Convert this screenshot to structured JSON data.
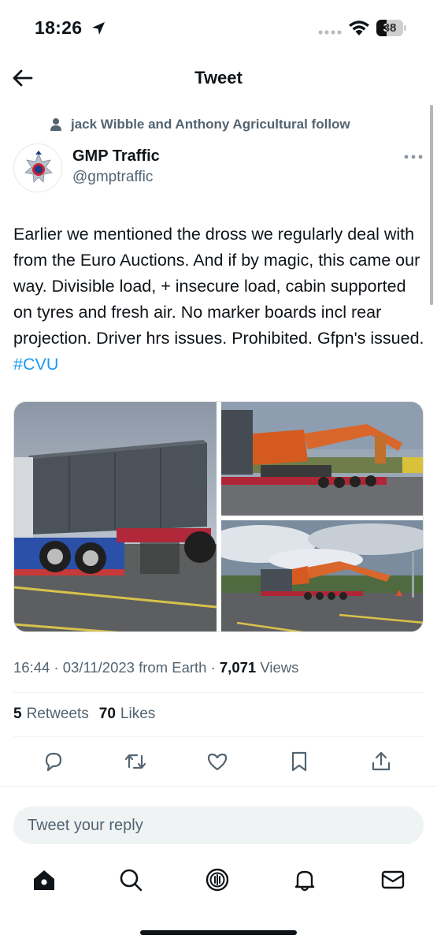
{
  "status_bar": {
    "time": "18:26",
    "battery": "38",
    "battery_level": 0.38
  },
  "header": {
    "title": "Tweet"
  },
  "social_context": "jack Wibble and Anthony Agricultural follow",
  "author": {
    "name": "GMP Traffic",
    "handle": "@gmptraffic"
  },
  "tweet": {
    "text": "Earlier we mentioned the dross we regularly deal with from the Euro Auctions. And if by magic, this came our way. Divisible load, + insecure load, cabin supported on tyres and fresh air. No marker boards incl rear projection. Driver hrs issues. Prohibited. Gfpn's issued.",
    "hashtag": "#CVU"
  },
  "meta": {
    "timestamp": "16:44 · 03/11/2023 from Earth · ",
    "views_count": "7,071",
    "views_label": " Views"
  },
  "stats": {
    "retweets_count": "5",
    "retweets_label": "Retweets",
    "likes_count": "70",
    "likes_label": "Likes"
  },
  "actions": [
    "reply-icon",
    "retweet-icon",
    "like-icon",
    "bookmark-icon",
    "share-icon"
  ],
  "reply": {
    "placeholder": "Tweet your reply"
  },
  "tabbar": [
    "home-icon",
    "search-icon",
    "spaces-icon",
    "notifications-icon",
    "messages-icon"
  ],
  "colors": {
    "accent": "#1d9bf0",
    "text": "#0f1419",
    "secondary": "#536471"
  }
}
